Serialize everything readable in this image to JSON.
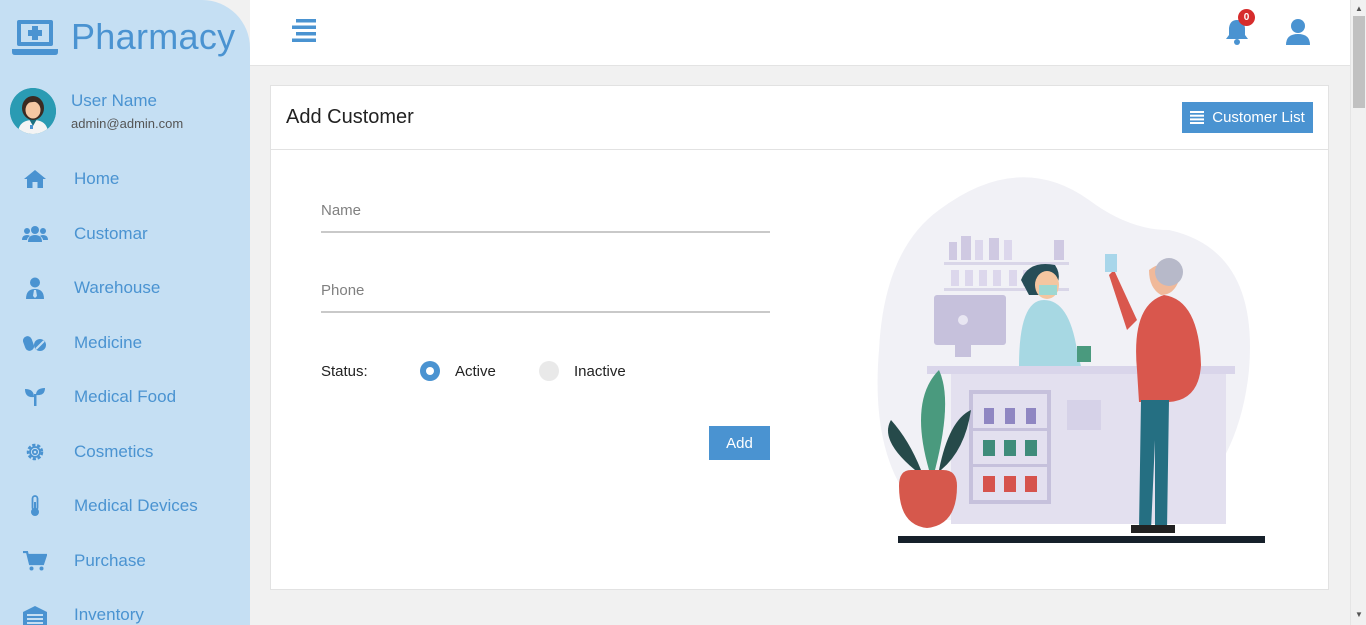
{
  "brand": {
    "title": "Pharmacy"
  },
  "user": {
    "name": "User Name",
    "email": "admin@admin.com"
  },
  "nav": [
    {
      "label": "Home",
      "icon": "home-icon"
    },
    {
      "label": "Customar",
      "icon": "users-icon"
    },
    {
      "label": "Warehouse",
      "icon": "user-tie-icon"
    },
    {
      "label": "Medicine",
      "icon": "pills-icon"
    },
    {
      "label": "Medical Food",
      "icon": "seedling-icon"
    },
    {
      "label": "Cosmetics",
      "icon": "gear-icon"
    },
    {
      "label": "Medical Devices",
      "icon": "thermometer-icon"
    },
    {
      "label": "Purchase",
      "icon": "cart-icon"
    },
    {
      "label": "Inventory",
      "icon": "warehouse-icon"
    }
  ],
  "topbar": {
    "notification_count": "0"
  },
  "card": {
    "title": "Add Customer",
    "list_button": "Customer List",
    "form": {
      "name_placeholder": "Name",
      "phone_placeholder": "Phone",
      "status_label": "Status:",
      "status_options": [
        "Active",
        "Inactive"
      ],
      "status_selected": "Active",
      "submit": "Add"
    }
  },
  "colors": {
    "accent": "#4a93d1",
    "sidebar_bg": "#c5dff3",
    "badge": "#d62c2c"
  }
}
